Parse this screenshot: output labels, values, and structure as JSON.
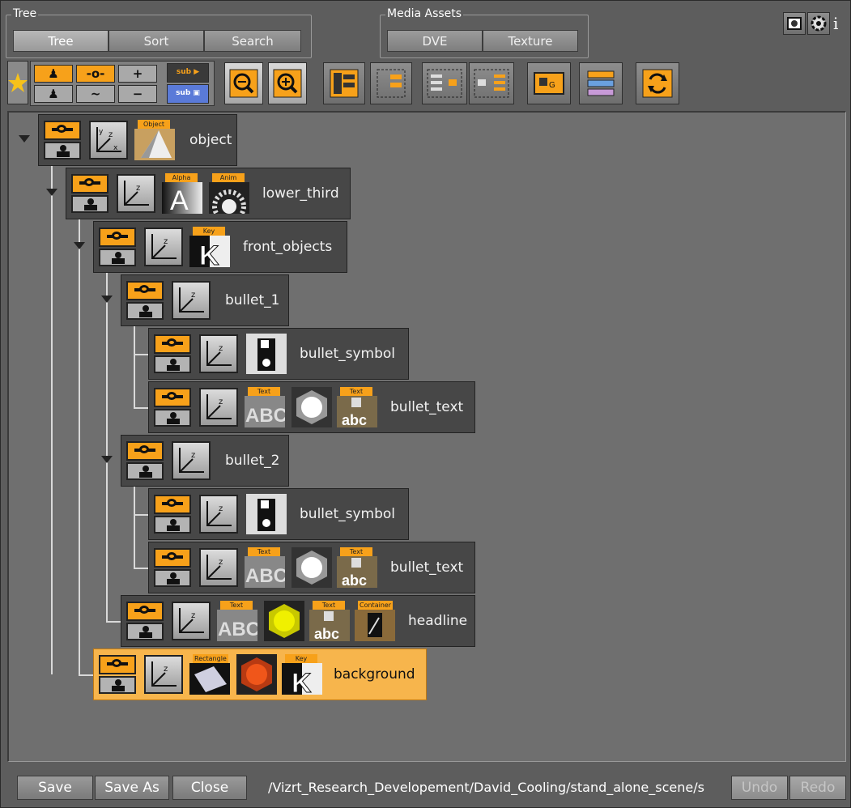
{
  "tree_group": {
    "title": "Tree",
    "tabs": [
      "Tree",
      "Sort",
      "Search"
    ],
    "active": "Tree"
  },
  "media_group": {
    "title": "Media Assets",
    "tabs": [
      "DVE",
      "Texture"
    ]
  },
  "toolbar_icons": [
    "favorite-star-icon",
    "enable-node-icon",
    "show-node-icon",
    "add-icon",
    "sub-dvs-icon",
    "disable-node-icon",
    "hide-node-icon",
    "remove-icon",
    "sub-dvs-alt-icon",
    "zoom-out-icon",
    "zoom-in-icon",
    "expand-tree-icon",
    "collapse-tree-icon",
    "merge-icon",
    "split-icon",
    "group-icon",
    "layers-icon",
    "refresh-icon"
  ],
  "top_right": {
    "icons": [
      "screenshot-icon",
      "gear-icon",
      "info-icon"
    ],
    "info_label": "i"
  },
  "tree_nodes": [
    {
      "name": "object",
      "plugins": [
        {
          "label": "Object",
          "icon": "cone-object-icon"
        }
      ],
      "selected": false
    },
    {
      "name": "lower_third",
      "plugins": [
        {
          "label": "Alpha",
          "icon": "alpha-icon"
        },
        {
          "label": "Anim",
          "icon": "anim-icon"
        }
      ],
      "selected": false
    },
    {
      "name": "front_objects",
      "plugins": [
        {
          "label": "Key",
          "icon": "key-icon"
        }
      ],
      "selected": false
    },
    {
      "name": "bullet_1",
      "plugins": [],
      "selected": false
    },
    {
      "name": "bullet_symbol",
      "plugins": [
        {
          "label": "",
          "icon": "bullet-symbol-icon"
        }
      ],
      "selected": false
    },
    {
      "name": "bullet_text",
      "plugins": [
        {
          "label": "Text",
          "icon": "text-abc-icon"
        },
        {
          "label": "",
          "icon": "sphere-icon"
        },
        {
          "label": "Text",
          "icon": "text-abc-small-icon"
        }
      ],
      "selected": false
    },
    {
      "name": "bullet_2",
      "plugins": [],
      "selected": false
    },
    {
      "name": "bullet_symbol",
      "plugins": [
        {
          "label": "",
          "icon": "bullet-symbol-icon"
        }
      ],
      "selected": false
    },
    {
      "name": "bullet_text",
      "plugins": [
        {
          "label": "Text",
          "icon": "text-abc-icon"
        },
        {
          "label": "",
          "icon": "sphere-icon"
        },
        {
          "label": "Text",
          "icon": "text-abc-small-icon"
        }
      ],
      "selected": false
    },
    {
      "name": "headline",
      "plugins": [
        {
          "label": "Text",
          "icon": "text-abc-icon"
        },
        {
          "label": "",
          "icon": "yellow-sphere-icon"
        },
        {
          "label": "Text",
          "icon": "text-abc-small-icon"
        },
        {
          "label": "Container",
          "icon": "container-icon"
        }
      ],
      "selected": false
    },
    {
      "name": "background",
      "plugins": [
        {
          "label": "Rectangle",
          "icon": "rectangle-icon"
        },
        {
          "label": "",
          "icon": "red-sphere-icon"
        },
        {
          "label": "Key",
          "icon": "key-icon"
        }
      ],
      "selected": true
    }
  ],
  "bottom": {
    "save": "Save",
    "save_as": "Save As",
    "close": "Close",
    "path": "/Vizrt_Research_Developement/David_Cooling/stand_alone_scene/s",
    "undo": "Undo",
    "redo": "Redo"
  },
  "colors": {
    "accent_orange": "#f7a11a",
    "selected_row": "#f7b54c",
    "panel": "#6f6f6f"
  }
}
